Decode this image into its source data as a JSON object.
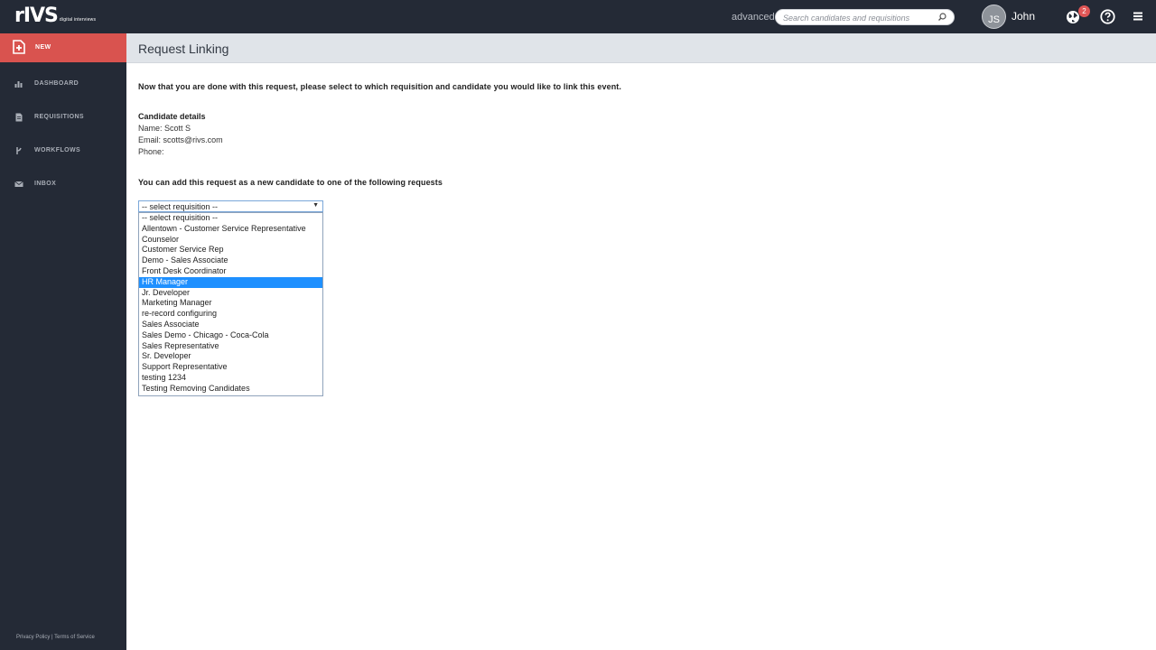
{
  "header": {
    "logo_word": "rIVS",
    "logo_sub": "digital interviews",
    "advanced_label": "advanced",
    "search_placeholder": "Search candidates and requisitions",
    "avatar_initials": "JS",
    "user_name": "John",
    "notification_count": "2"
  },
  "sidebar": {
    "new_label": "NEW",
    "items": [
      {
        "label": "DASHBOARD",
        "icon": "bar-chart-icon"
      },
      {
        "label": "REQUISITIONS",
        "icon": "document-icon"
      },
      {
        "label": "WORKFLOWS",
        "icon": "workflow-icon"
      },
      {
        "label": "INBOX",
        "icon": "envelope-icon"
      }
    ],
    "footer": {
      "privacy": "Privacy Policy",
      "separator": "|",
      "terms": "Terms of Service"
    }
  },
  "main": {
    "title": "Request Linking",
    "intro": "Now that you are done with this request, please select to which requisition and candidate you would like to link this event.",
    "candidate": {
      "heading": "Candidate details",
      "name": "Name: Scott S",
      "email": "Email: scotts@rivs.com",
      "phone": "Phone:"
    },
    "add_text": "You can add this request as a new candidate to one of the following requests",
    "select": {
      "value": "-- select requisition --",
      "options": [
        "-- select requisition --",
        "Allentown - Customer Service Representative",
        "Counselor",
        "Customer Service Rep",
        "Demo - Sales Associate",
        "Front Desk Coordinator",
        "HR Manager",
        "Jr. Developer",
        "Marketing Manager",
        "re-record configuring",
        "Sales Associate",
        "Sales Demo - Chicago - Coca-Cola",
        "Sales Representative",
        "Sr. Developer",
        "Support Representative",
        "testing 1234",
        "Testing Removing Candidates"
      ],
      "highlighted_index": 6
    }
  },
  "colors": {
    "topbar": "#242a36",
    "new_button": "#d9534f",
    "highlight": "#1e90ff",
    "badge": "#e05656"
  }
}
